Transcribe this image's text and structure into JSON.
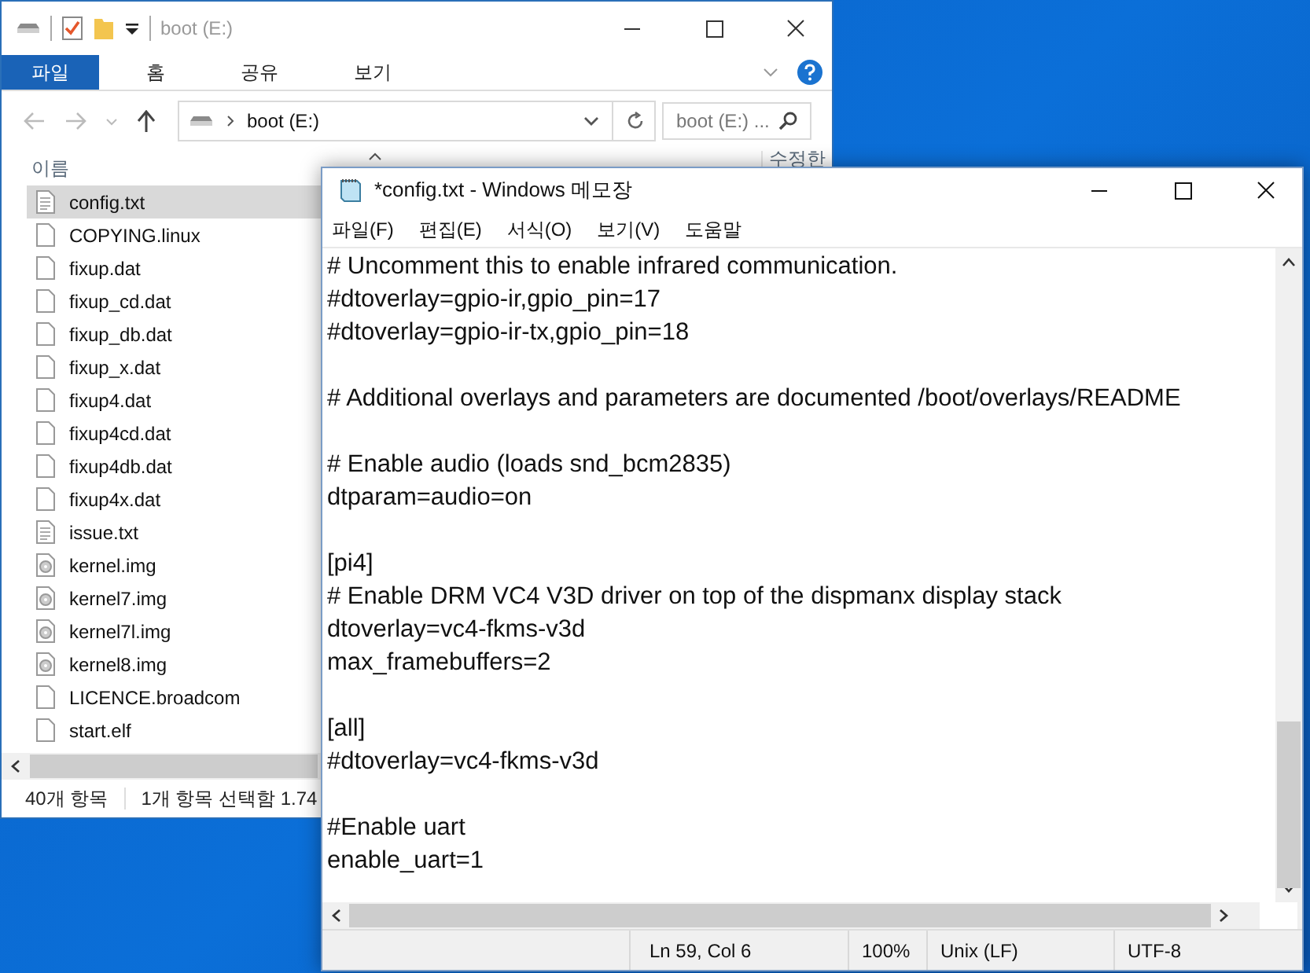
{
  "explorer": {
    "title": "boot (E:)",
    "ribbon_tabs": [
      {
        "label": "파일",
        "selected": true
      },
      {
        "label": "홈",
        "selected": false
      },
      {
        "label": "공유",
        "selected": false
      },
      {
        "label": "보기",
        "selected": false
      }
    ],
    "address": "boot (E:)",
    "search": {
      "placeholder": "boot (E:) ..."
    },
    "columns": [
      "이름",
      "수정한"
    ],
    "files": [
      {
        "name": "config.txt",
        "kind": "text",
        "selected": true
      },
      {
        "name": "COPYING.linux",
        "kind": "blank",
        "selected": false
      },
      {
        "name": "fixup.dat",
        "kind": "blank",
        "selected": false
      },
      {
        "name": "fixup_cd.dat",
        "kind": "blank",
        "selected": false
      },
      {
        "name": "fixup_db.dat",
        "kind": "blank",
        "selected": false
      },
      {
        "name": "fixup_x.dat",
        "kind": "blank",
        "selected": false
      },
      {
        "name": "fixup4.dat",
        "kind": "blank",
        "selected": false
      },
      {
        "name": "fixup4cd.dat",
        "kind": "blank",
        "selected": false
      },
      {
        "name": "fixup4db.dat",
        "kind": "blank",
        "selected": false
      },
      {
        "name": "fixup4x.dat",
        "kind": "blank",
        "selected": false
      },
      {
        "name": "issue.txt",
        "kind": "text",
        "selected": false
      },
      {
        "name": "kernel.img",
        "kind": "image",
        "selected": false
      },
      {
        "name": "kernel7.img",
        "kind": "image",
        "selected": false
      },
      {
        "name": "kernel7l.img",
        "kind": "image",
        "selected": false
      },
      {
        "name": "kernel8.img",
        "kind": "image",
        "selected": false
      },
      {
        "name": "LICENCE.broadcom",
        "kind": "blank",
        "selected": false
      },
      {
        "name": "start.elf",
        "kind": "blank",
        "selected": false
      }
    ],
    "status_bar": [
      "40개 항목",
      "1개 항목 선택함 1.74"
    ]
  },
  "notepad": {
    "title": "*config.txt - Windows 메모장",
    "menu": [
      "파일(F)",
      "편집(E)",
      "서식(O)",
      "보기(V)",
      "도움말"
    ],
    "paragraphs": [
      [
        "# Uncomment this to enable infrared communication.",
        "#dtoverlay=gpio-ir,gpio_pin=17",
        "#dtoverlay=gpio-ir-tx,gpio_pin=18"
      ],
      [
        "# Additional overlays and parameters are documented /boot/overlays/README"
      ],
      [
        "# Enable audio (loads snd_bcm2835)",
        "dtparam=audio=on"
      ],
      [
        "[pi4]",
        "# Enable DRM VC4 V3D driver on top of the dispmanx display stack",
        "dtoverlay=vc4-fkms-v3d",
        "max_framebuffers=2"
      ],
      [
        "[all]",
        "#dtoverlay=vc4-fkms-v3d"
      ],
      [
        "#Enable uart",
        "enable_uart=1"
      ]
    ],
    "status_bar": [
      "Ln 59, Col 6",
      "100%",
      "Unix (LF)",
      "UTF-8"
    ]
  }
}
